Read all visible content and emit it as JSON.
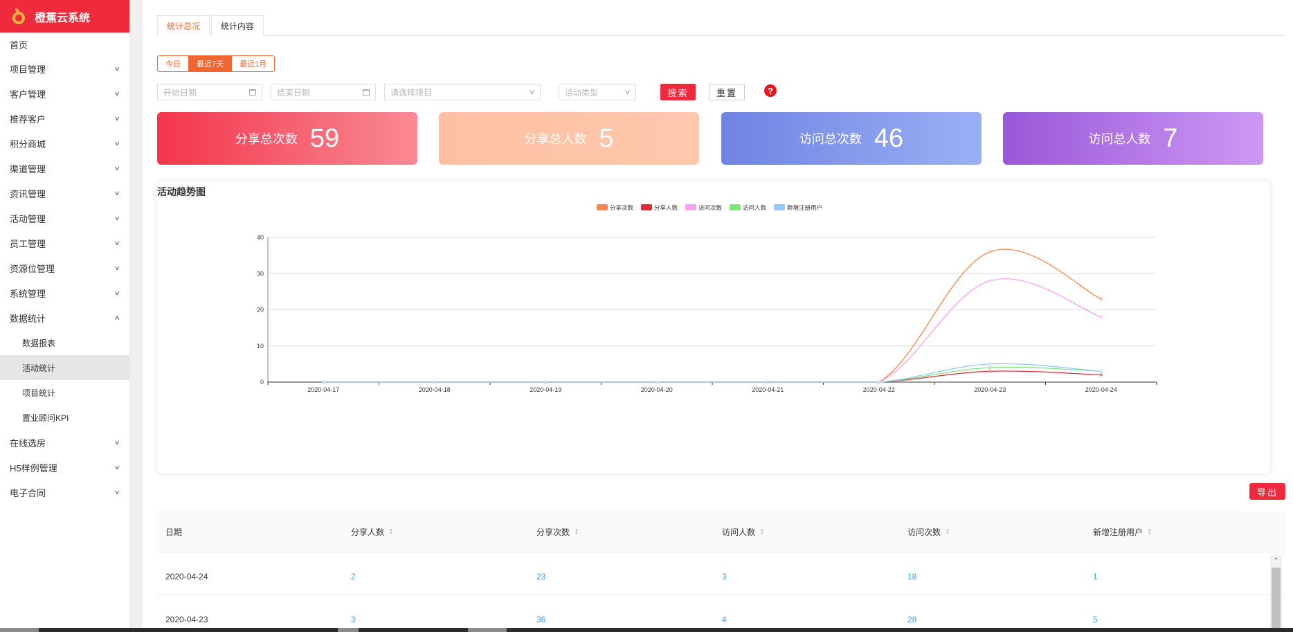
{
  "app": {
    "name": "橙蕉云系统"
  },
  "sidebar": {
    "home": "首页",
    "items": [
      {
        "label": "项目管理"
      },
      {
        "label": "客户管理"
      },
      {
        "label": "推荐客户"
      },
      {
        "label": "积分商城"
      },
      {
        "label": "渠道管理"
      },
      {
        "label": "资讯管理"
      },
      {
        "label": "活动管理"
      },
      {
        "label": "员工管理"
      },
      {
        "label": "资源位管理"
      },
      {
        "label": "系统管理"
      }
    ],
    "expanded": {
      "label": "数据统计",
      "children": [
        "数据报表",
        "活动统计",
        "项目统计",
        "置业顾问KPI"
      ],
      "active": "活动统计"
    },
    "after": [
      {
        "label": "在线选房"
      },
      {
        "label": "H5样例管理"
      },
      {
        "label": "电子合同"
      }
    ]
  },
  "tabs": [
    "统计总况",
    "统计内容"
  ],
  "range": {
    "options": [
      "今日",
      "最近7天",
      "最近1月"
    ],
    "selected": "最近7天"
  },
  "filters": {
    "start_date": "开始日期",
    "end_date": "结束日期",
    "project": "请选择项目",
    "activity_type": "活动类型",
    "search": "搜索",
    "reset": "重置",
    "help": "?"
  },
  "cards": [
    {
      "label": "分享总次数",
      "value": "59",
      "from": "#f3354a",
      "to": "#f98a95"
    },
    {
      "label": "分享总人数",
      "value": "5",
      "from": "#fec0a2",
      "to": "#ffc8ad"
    },
    {
      "label": "访问总次数",
      "value": "46",
      "from": "#6f84e2",
      "to": "#9ab0f5"
    },
    {
      "label": "访问总人数",
      "value": "7",
      "from": "#9a58d8",
      "to": "#cd98f4"
    }
  ],
  "chart": {
    "title": "活动趋势图"
  },
  "chart_data": {
    "type": "line",
    "x": [
      "2020-04-17",
      "2020-04-18",
      "2020-04-19",
      "2020-04-20",
      "2020-04-21",
      "2020-04-22",
      "2020-04-23",
      "2020-04-24"
    ],
    "series": [
      {
        "name": "分享次数",
        "color": "#f8854f",
        "values": [
          0,
          0,
          0,
          0,
          0,
          0,
          36,
          23
        ]
      },
      {
        "name": "分享人数",
        "color": "#e32b3a",
        "values": [
          0,
          0,
          0,
          0,
          0,
          0,
          3,
          2
        ]
      },
      {
        "name": "访问次数",
        "color": "#f8a1f4",
        "values": [
          0,
          0,
          0,
          0,
          0,
          0,
          28,
          18
        ]
      },
      {
        "name": "访问人数",
        "color": "#7fe57f",
        "values": [
          0,
          0,
          0,
          0,
          0,
          0,
          4,
          3
        ]
      },
      {
        "name": "新增注册用户",
        "color": "#94c9f5",
        "values": [
          0,
          0,
          0,
          0,
          0,
          0,
          5,
          3
        ]
      }
    ],
    "yticks": [
      0,
      10,
      20,
      30,
      40
    ],
    "ylim": [
      0,
      40
    ],
    "legend": "top-center",
    "grid": true
  },
  "export": "导出",
  "table": {
    "columns": [
      "日期",
      "分享人数",
      "分享次数",
      "访问人数",
      "访问次数",
      "新增注册用户"
    ],
    "rows": [
      [
        "2020-04-24",
        "2",
        "23",
        "3",
        "18",
        "1"
      ],
      [
        "2020-04-23",
        "3",
        "36",
        "4",
        "28",
        "5"
      ]
    ]
  }
}
